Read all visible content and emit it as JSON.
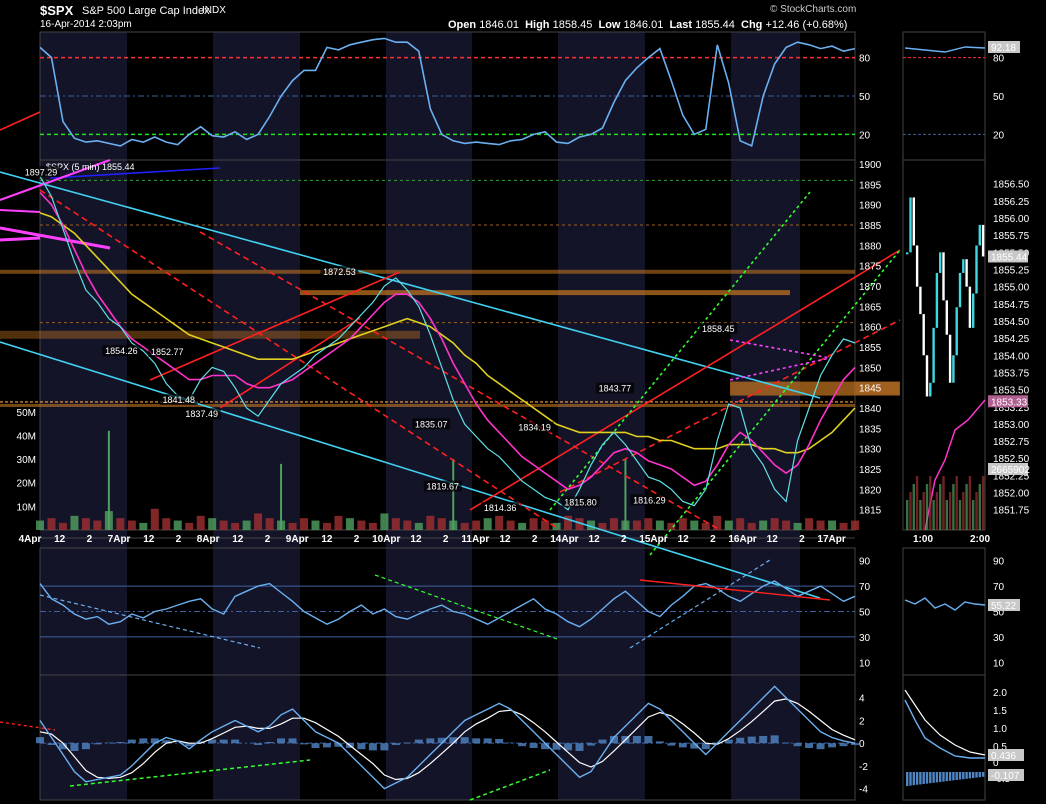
{
  "header": {
    "symbol": "$SPX",
    "name": "S&P 500 Large Cap Index",
    "exchange": "INDX",
    "date": "16-Apr-2014 2:03pm",
    "brand": "© StockCharts.com",
    "open_label": "Open",
    "open": "1846.01",
    "high_label": "High",
    "high": "1858.45",
    "low_label": "Low",
    "low": "1846.01",
    "last_label": "Last",
    "last": "1855.44",
    "chg_label": "Chg",
    "chg": "+12.46 (+0.68%)"
  },
  "colors": {
    "price": "#5ee0e8",
    "ma_fast": "#ff33cc",
    "ma_slow": "#e0d020",
    "trend_red": "#ff2020",
    "trend_cyan": "#40d0f0",
    "trend_green": "#30ff30",
    "volume": "#50a060",
    "rsi": "#6ab0f0",
    "overbought": "#ff3030",
    "oversold": "#20e020",
    "resistance": "#c87820",
    "macd_hist": "#4f86c6"
  },
  "chart_data": [
    {
      "id": "rsi-top",
      "type": "line",
      "ylim": [
        0,
        100
      ],
      "y_ticks": [
        "80",
        "50",
        "20"
      ],
      "levels": {
        "overbought": 80,
        "mid": 50,
        "oversold": 20
      },
      "series": [
        {
          "values": [
            88,
            80,
            30,
            17,
            14,
            15,
            13,
            11,
            16,
            14,
            18,
            14,
            12,
            20,
            26,
            19,
            18,
            22,
            16,
            20,
            34,
            50,
            62,
            70,
            70,
            88,
            86,
            90,
            92,
            94,
            95,
            92,
            92,
            85,
            40,
            20,
            15,
            13,
            14,
            13,
            12,
            15,
            16,
            20,
            22,
            14,
            13,
            18,
            20,
            25,
            45,
            62,
            72,
            80,
            87,
            62,
            35,
            20,
            24,
            90,
            60,
            15,
            11,
            50,
            75,
            88,
            92,
            90,
            87,
            89,
            85,
            87
          ]
        }
      ],
      "mini_value": "92.18",
      "mini_ticks": [
        "80",
        "50",
        "20"
      ]
    },
    {
      "id": "price",
      "type": "line",
      "title": "$SPX (5 min) 1855.44",
      "ylim": [
        1810,
        1901
      ],
      "y_ticks": [
        "1900",
        "1895",
        "1890",
        "1885",
        "1880",
        "1875",
        "1870",
        "1865",
        "1860",
        "1855",
        "1850",
        "1845",
        "1840",
        "1835",
        "1830",
        "1825",
        "1820",
        "1815"
      ],
      "x_ticks": [
        "4Apr",
        "12",
        "2",
        "7Apr",
        "12",
        "2",
        "8Apr",
        "12",
        "2",
        "9Apr",
        "12",
        "2",
        "10Apr",
        "12",
        "2",
        "11Apr",
        "12",
        "2",
        "14Apr",
        "12",
        "2",
        "15Apr",
        "12",
        "2",
        "16Apr",
        "12",
        "2",
        "17Apr"
      ],
      "series": [
        {
          "values": [
            1897,
            1892,
            1884,
            1876,
            1869,
            1866,
            1862,
            1860,
            1856,
            1854,
            1851,
            1846,
            1843,
            1842,
            1847,
            1850,
            1849,
            1845,
            1840,
            1838,
            1842,
            1846,
            1848,
            1850,
            1853,
            1855,
            1857,
            1860,
            1863,
            1866,
            1870,
            1872,
            1869,
            1865,
            1858,
            1850,
            1842,
            1836,
            1833,
            1830,
            1828,
            1825,
            1822,
            1820,
            1818,
            1817,
            1815,
            1820,
            1826,
            1831,
            1834,
            1831,
            1827,
            1823,
            1822,
            1820,
            1817,
            1816,
            1820,
            1832,
            1841,
            1840,
            1830,
            1826,
            1820,
            1817,
            1832,
            1840,
            1848,
            1853,
            1857,
            1856
          ]
        },
        {
          "values": [
            1893,
            1890,
            1885,
            1879,
            1873,
            1868,
            1864,
            1860,
            1857,
            1855,
            1853,
            1851,
            1849,
            1847,
            1847,
            1848,
            1848,
            1848,
            1846,
            1845,
            1845,
            1846,
            1847,
            1849,
            1851,
            1853,
            1855,
            1857,
            1860,
            1863,
            1866,
            1868,
            1868,
            1866,
            1862,
            1857,
            1851,
            1846,
            1841,
            1837,
            1834,
            1831,
            1828,
            1826,
            1824,
            1822,
            1820,
            1821,
            1823,
            1826,
            1829,
            1830,
            1829,
            1827,
            1826,
            1825,
            1823,
            1821,
            1822,
            1826,
            1831,
            1834,
            1832,
            1829,
            1826,
            1824,
            1826,
            1831,
            1837,
            1842,
            1847,
            1850
          ]
        },
        {
          "values": [
            1888,
            1887,
            1885,
            1883,
            1880,
            1877,
            1874,
            1871,
            1868,
            1866,
            1864,
            1862,
            1860,
            1858,
            1857,
            1856,
            1855,
            1854,
            1853,
            1852,
            1852,
            1852,
            1852,
            1853,
            1854,
            1855,
            1856,
            1857,
            1858,
            1859,
            1860,
            1861,
            1862,
            1861,
            1860,
            1858,
            1856,
            1853,
            1851,
            1848,
            1846,
            1844,
            1842,
            1840,
            1838,
            1836,
            1835,
            1834,
            1834,
            1834,
            1834,
            1834,
            1833,
            1833,
            1832,
            1832,
            1831,
            1830,
            1830,
            1830,
            1831,
            1831,
            1831,
            1830,
            1830,
            1829,
            1829,
            1830,
            1832,
            1834,
            1837,
            1840
          ]
        }
      ],
      "data_labels": [
        {
          "text": "1897.29",
          "i": 0,
          "y": 1897
        },
        {
          "text": "1854.26",
          "i": 7,
          "y": 1853
        },
        {
          "text": "1852.77",
          "i": 11,
          "y": 1852.8
        },
        {
          "text": "1841.48",
          "i": 12,
          "y": 1841
        },
        {
          "text": "1837.49",
          "i": 14,
          "y": 1837.5
        },
        {
          "text": "1872.53",
          "i": 26,
          "y": 1872.5
        },
        {
          "text": "1835.07",
          "i": 34,
          "y": 1835
        },
        {
          "text": "1819.67",
          "i": 35,
          "y": 1819.7
        },
        {
          "text": "1814.36",
          "i": 40,
          "y": 1814.4
        },
        {
          "text": "1834.19",
          "i": 43,
          "y": 1834.2
        },
        {
          "text": "1815.80",
          "i": 47,
          "y": 1815.8
        },
        {
          "text": "1843.77",
          "i": 50,
          "y": 1843.8
        },
        {
          "text": "1816.29",
          "i": 53,
          "y": 1816.3
        },
        {
          "text": "1858.45",
          "i": 59,
          "y": 1858.5
        }
      ],
      "last_value": "1855.44",
      "mid_label": "1845",
      "mini_ticks": [
        "1856.50",
        "1856.25",
        "1856.00",
        "1855.75",
        "1855.50",
        "1855.25",
        "1855.00",
        "1854.75",
        "1854.50",
        "1854.25",
        "1854.00",
        "1853.75",
        "1853.50",
        "1853.25",
        "1853.00",
        "1852.75",
        "1852.50",
        "1852.25",
        "1852.00",
        "1851.75"
      ],
      "mini_last": "1855.44",
      "mini_ma": "1853.33",
      "mini_vol": "2665902",
      "mini_x": [
        "1:00",
        "2:00"
      ]
    },
    {
      "id": "volume",
      "type": "bar",
      "y_ticks": [
        "50M",
        "40M",
        "30M",
        "20M",
        "10M"
      ],
      "ylim": [
        0,
        55
      ],
      "values": [
        4,
        5,
        3,
        6,
        5,
        4,
        8,
        5,
        4,
        3,
        9,
        5,
        4,
        3,
        6,
        5,
        4,
        3,
        4,
        7,
        5,
        4,
        3,
        5,
        4,
        3,
        6,
        5,
        4,
        3,
        7,
        5,
        4,
        3,
        6,
        5,
        4,
        3,
        4,
        5,
        6,
        4,
        3,
        5,
        4,
        3,
        6,
        5,
        4,
        3,
        5,
        4,
        4,
        5,
        4,
        3,
        5,
        4,
        3,
        6,
        4,
        5,
        3,
        4,
        5,
        4,
        3,
        5,
        4,
        4,
        3,
        4
      ],
      "spikes": [
        {
          "i": 6,
          "v": 42
        },
        {
          "i": 21,
          "v": 28
        },
        {
          "i": 36,
          "v": 30
        },
        {
          "i": 51,
          "v": 30
        }
      ]
    },
    {
      "id": "rsi-mid",
      "type": "line",
      "ylim": [
        0,
        100
      ],
      "y_ticks": [
        "90",
        "70",
        "50",
        "30",
        "10"
      ],
      "series": [
        {
          "values": [
            72,
            60,
            55,
            48,
            44,
            46,
            40,
            42,
            48,
            45,
            50,
            52,
            55,
            58,
            60,
            52,
            48,
            62,
            66,
            70,
            72,
            65,
            58,
            50,
            45,
            40,
            44,
            50,
            55,
            48,
            52,
            46,
            44,
            48,
            52,
            55,
            50,
            48,
            44,
            40,
            45,
            50,
            55,
            60,
            52,
            48,
            42,
            38,
            44,
            52,
            60,
            66,
            58,
            50,
            46,
            55,
            62,
            70,
            72,
            68,
            62,
            58,
            64,
            70,
            74,
            68,
            62,
            66,
            70,
            64,
            58,
            62
          ]
        }
      ],
      "mini_value": "55.22",
      "mini_ticks": [
        "90",
        "70",
        "50",
        "30",
        "10"
      ]
    },
    {
      "id": "macd",
      "type": "line",
      "ylim": [
        -5,
        6
      ],
      "y_ticks": [
        "4",
        "2",
        "0",
        "-2",
        "-4"
      ],
      "series": [
        {
          "values": [
            2,
            0.5,
            -1,
            -2.5,
            -3.4,
            -3.2,
            -3,
            -2.8,
            -2,
            -1,
            0,
            0.5,
            0.2,
            -0.5,
            0.3,
            1,
            1.5,
            2,
            1.5,
            1,
            1.5,
            2.5,
            3,
            2,
            1,
            0.5,
            0,
            -1,
            -2,
            -3,
            -4,
            -3.5,
            -3,
            -2,
            -1,
            0,
            1,
            2,
            2.5,
            3,
            3.5,
            3,
            2,
            1,
            0,
            -1,
            -2,
            -3,
            -2.5,
            -1,
            0.5,
            1.5,
            2.5,
            3.5,
            3,
            2,
            1,
            0,
            -1,
            0,
            1,
            2,
            3,
            4,
            5,
            4,
            3,
            2,
            1,
            0.5,
            0.2,
            0
          ]
        },
        {
          "values": [
            1,
            0.8,
            0,
            -1.2,
            -2.4,
            -3,
            -3.1,
            -3,
            -2.6,
            -1.8,
            -0.8,
            0,
            0.2,
            0,
            0,
            0.4,
            0.9,
            1.4,
            1.5,
            1.3,
            1.3,
            1.7,
            2.2,
            2.2,
            1.8,
            1.2,
            0.6,
            -0.2,
            -1,
            -1.8,
            -2.8,
            -3.2,
            -3.1,
            -2.6,
            -1.8,
            -0.9,
            0,
            1,
            1.7,
            2.2,
            2.8,
            2.9,
            2.5,
            1.8,
            1,
            0.1,
            -0.8,
            -1.7,
            -2.1,
            -1.6,
            -0.7,
            0.3,
            1.3,
            2.3,
            2.7,
            2.4,
            1.7,
            0.9,
            0,
            -0.1,
            0.4,
            1.1,
            1.9,
            2.8,
            3.7,
            3.9,
            3.5,
            2.8,
            2,
            1.2,
            0.7,
            0.3
          ]
        }
      ],
      "mini_ticks": [
        "2.0",
        "1.5",
        "1.0",
        "0.5",
        "0",
        "-0.5"
      ],
      "mini_value_a": "0.436",
      "mini_value_b": "-0.107"
    }
  ]
}
